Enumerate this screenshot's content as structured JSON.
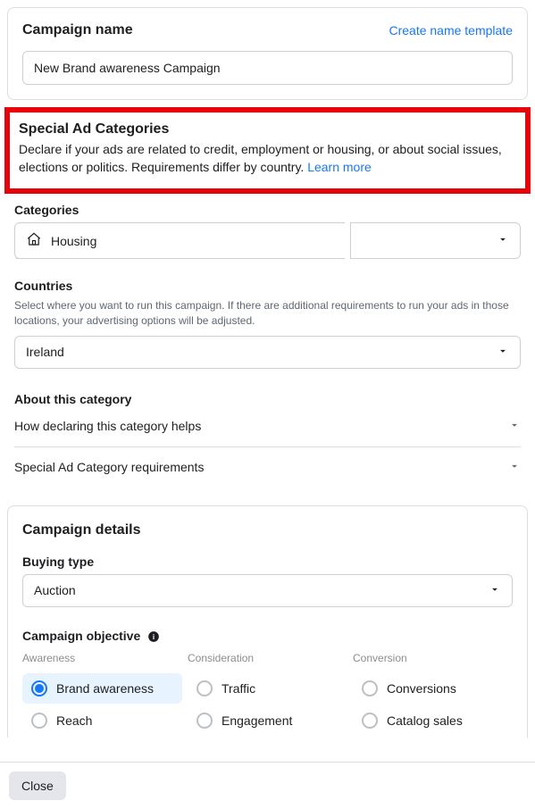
{
  "campaign_name": {
    "title": "Campaign name",
    "template_link": "Create name template",
    "value": "New Brand awareness Campaign"
  },
  "special": {
    "title": "Special Ad Categories",
    "desc": "Declare if your ads are related to credit, employment or housing, or about social issues, elections or politics. Requirements differ by country. ",
    "learn_more": "Learn more",
    "categories_label": "Categories",
    "category_selected": "Housing",
    "countries_label": "Countries",
    "countries_desc": "Select where you want to run this campaign. If there are additional requirements to run your ads in those locations, your advertising options will be adjusted.",
    "country_selected": "Ireland",
    "about_label": "About this category",
    "how_helps": "How declaring this category helps",
    "requirements": "Special Ad Category requirements"
  },
  "details": {
    "title": "Campaign details",
    "buying_type_label": "Buying type",
    "buying_type_value": "Auction",
    "objective_label": "Campaign objective",
    "cols": {
      "awareness": "Awareness",
      "consideration": "Consideration",
      "conversion": "Conversion"
    },
    "options": {
      "brand_awareness": "Brand awareness",
      "reach": "Reach",
      "traffic": "Traffic",
      "engagement": "Engagement",
      "conversions": "Conversions",
      "catalog_sales": "Catalog sales"
    }
  },
  "footer": {
    "close": "Close"
  }
}
